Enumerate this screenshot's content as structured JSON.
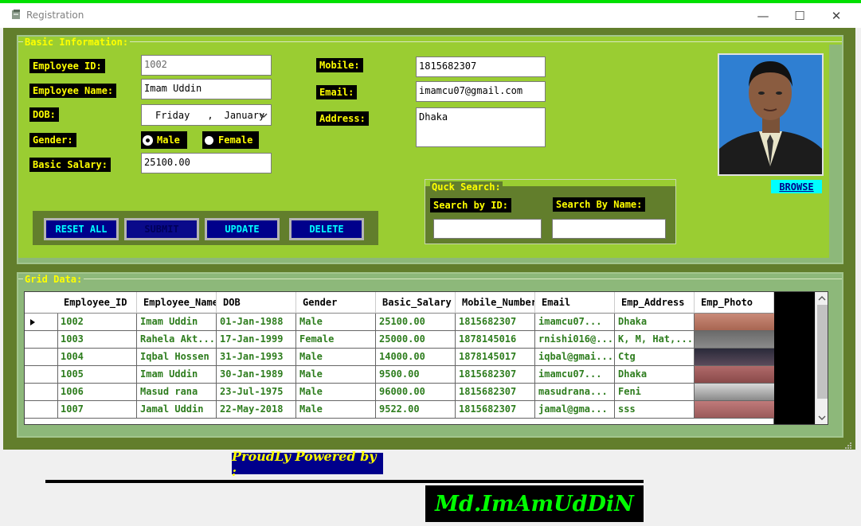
{
  "window": {
    "title": "Registration",
    "minimize": "—",
    "maximize": "☐",
    "close": "✕"
  },
  "basic_info": {
    "legend": "Basic Information:",
    "employee_id_label": "Employee ID:",
    "employee_id_value": "1002",
    "employee_name_label": "Employee Name:",
    "employee_name_value": "Imam Uddin",
    "dob_label": "DOB:",
    "dob_day": "Friday",
    "dob_sep": ",",
    "dob_month": "January",
    "gender_label": "Gender:",
    "gender_male": "Male",
    "gender_female": "Female",
    "gender_selected": "Male",
    "salary_label": "Basic Salary:",
    "salary_value": "25100.00",
    "mobile_label": "Mobile:",
    "mobile_value": "1815682307",
    "email_label": "Email:",
    "email_value": "imamcu07@gmail.com",
    "address_label": "Address:",
    "address_value": "Dhaka",
    "browse_label": "BROWSE"
  },
  "buttons": {
    "reset": "RESET ALL",
    "submit": "SUBMIT",
    "update": "UPDATE",
    "delete": "DELETE"
  },
  "search": {
    "legend": "Quck Search:",
    "by_id_label": "Search by ID:",
    "by_name_label": "Search By Name:",
    "by_id_value": "",
    "by_name_value": ""
  },
  "grid": {
    "legend": "Grid Data:",
    "columns": [
      "Employee_ID",
      "Employee_Name",
      "DOB",
      "Gender",
      "Basic_Salary",
      "Mobile_Number",
      "Email",
      "Emp_Address",
      "Emp_Photo"
    ],
    "rows": [
      [
        "1002",
        "Imam Uddin",
        "01-Jan-1988",
        "Male",
        "25100.00",
        "1815682307",
        "imamcu07...",
        "Dhaka"
      ],
      [
        "1003",
        "Rahela Akt...",
        "17-Jan-1999",
        "Female",
        "25000.00",
        "1878145016",
        "rnishi016@...",
        "K, M, Hat,..."
      ],
      [
        "1004",
        "Iqbal Hossen",
        "31-Jan-1993",
        "Male",
        "14000.00",
        "1878145017",
        "iqbal@gmai...",
        "Ctg"
      ],
      [
        "1005",
        "Imam Uddin",
        "30-Jan-1989",
        "Male",
        "9500.00",
        "1815682307",
        "imamcu07...",
        "Dhaka"
      ],
      [
        "1006",
        "Masud rana",
        "23-Jul-1975",
        "Male",
        "96000.00",
        "1815682307",
        "masudrana...",
        "Feni"
      ],
      [
        "1007",
        "Jamal Uddin",
        "22-May-2018",
        "Male",
        "9522.00",
        "1815682307",
        "jamal@gma...",
        "sss"
      ]
    ]
  },
  "credits": {
    "powered_by": "ProudLy Powered by :",
    "author": "Md.ImAmUdDiN"
  },
  "colors": {
    "accent_label_bg": "#000000",
    "label_text": "#ffff00",
    "panel": "#9acd32",
    "frame": "#627e2c",
    "button_bg": "#00008b",
    "button_text": "#00ffff",
    "grid_text": "#2e7d1e"
  }
}
